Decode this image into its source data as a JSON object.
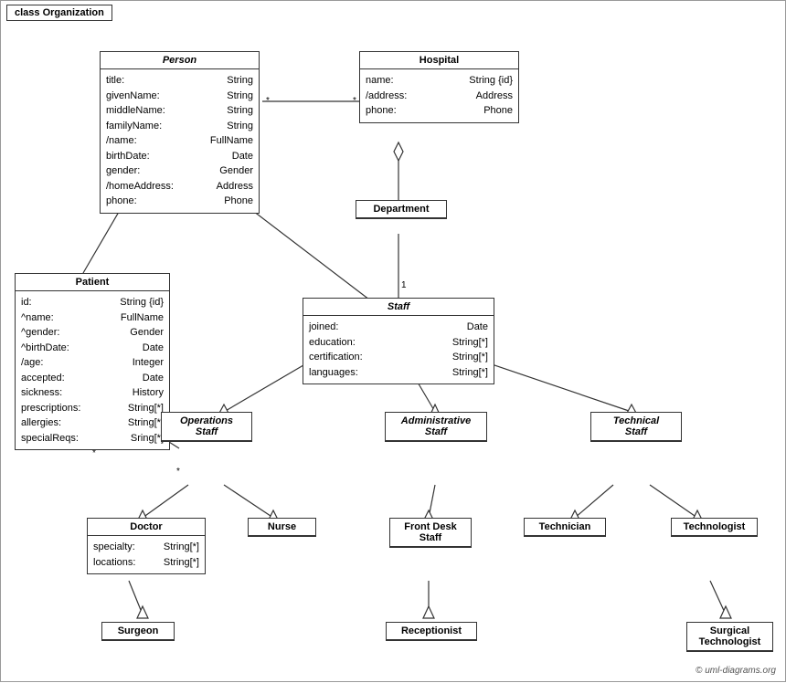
{
  "diagram": {
    "title": "class Organization",
    "copyright": "© uml-diagrams.org",
    "classes": {
      "person": {
        "name": "Person",
        "italic": true,
        "attrs": [
          {
            "name": "title:",
            "type": "String"
          },
          {
            "name": "givenName:",
            "type": "String"
          },
          {
            "name": "middleName:",
            "type": "String"
          },
          {
            "name": "familyName:",
            "type": "String"
          },
          {
            "name": "/name:",
            "type": "FullName"
          },
          {
            "name": "birthDate:",
            "type": "Date"
          },
          {
            "name": "gender:",
            "type": "Gender"
          },
          {
            "name": "/homeAddress:",
            "type": "Address"
          },
          {
            "name": "phone:",
            "type": "Phone"
          }
        ]
      },
      "hospital": {
        "name": "Hospital",
        "italic": false,
        "attrs": [
          {
            "name": "name:",
            "type": "String {id}"
          },
          {
            "name": "/address:",
            "type": "Address"
          },
          {
            "name": "phone:",
            "type": "Phone"
          }
        ]
      },
      "patient": {
        "name": "Patient",
        "italic": false,
        "attrs": [
          {
            "name": "id:",
            "type": "String {id}"
          },
          {
            "name": "^name:",
            "type": "FullName"
          },
          {
            "name": "^gender:",
            "type": "Gender"
          },
          {
            "name": "^birthDate:",
            "type": "Date"
          },
          {
            "name": "/age:",
            "type": "Integer"
          },
          {
            "name": "accepted:",
            "type": "Date"
          },
          {
            "name": "sickness:",
            "type": "History"
          },
          {
            "name": "prescriptions:",
            "type": "String[*]"
          },
          {
            "name": "allergies:",
            "type": "String[*]"
          },
          {
            "name": "specialReqs:",
            "type": "Sring[*]"
          }
        ]
      },
      "department": {
        "name": "Department",
        "italic": false,
        "attrs": []
      },
      "staff": {
        "name": "Staff",
        "italic": true,
        "attrs": [
          {
            "name": "joined:",
            "type": "Date"
          },
          {
            "name": "education:",
            "type": "String[*]"
          },
          {
            "name": "certification:",
            "type": "String[*]"
          },
          {
            "name": "languages:",
            "type": "String[*]"
          }
        ]
      },
      "operations_staff": {
        "name": "Operations\nStaff",
        "italic": true
      },
      "administrative_staff": {
        "name": "Administrative\nStaff",
        "italic": true
      },
      "technical_staff": {
        "name": "Technical\nStaff",
        "italic": true
      },
      "doctor": {
        "name": "Doctor",
        "italic": false,
        "attrs": [
          {
            "name": "specialty:",
            "type": "String[*]"
          },
          {
            "name": "locations:",
            "type": "String[*]"
          }
        ]
      },
      "nurse": {
        "name": "Nurse",
        "italic": false,
        "attrs": []
      },
      "front_desk_staff": {
        "name": "Front Desk\nStaff",
        "italic": false,
        "attrs": []
      },
      "technician": {
        "name": "Technician",
        "italic": false,
        "attrs": []
      },
      "technologist": {
        "name": "Technologist",
        "italic": false,
        "attrs": []
      },
      "surgeon": {
        "name": "Surgeon",
        "italic": false,
        "attrs": []
      },
      "receptionist": {
        "name": "Receptionist",
        "italic": false,
        "attrs": []
      },
      "surgical_technologist": {
        "name": "Surgical\nTechnologist",
        "italic": false,
        "attrs": []
      }
    }
  }
}
